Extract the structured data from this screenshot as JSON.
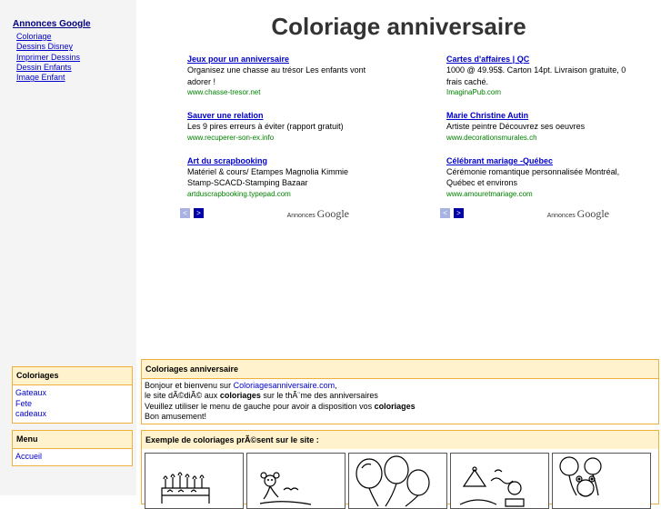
{
  "left": {
    "google_heading": "Annonces Google",
    "google_links": [
      "Coloriage",
      "Dessins Disney",
      "Imprimer Dessins",
      "Dessin Enfants",
      "Image Enfant"
    ],
    "coloriages_box": {
      "title": "Coloriages",
      "items": [
        "Gateaux",
        "Fete",
        "cadeaux"
      ]
    },
    "menu_box": {
      "title": "Menu",
      "items": [
        "Accueil"
      ]
    }
  },
  "main": {
    "title": "Coloriage anniversaire",
    "ads_left": [
      {
        "title": "Jeux pour un anniversaire",
        "text": "Organisez une chasse au trésor Les enfants vont adorer !",
        "url": "www.chasse-tresor.net"
      },
      {
        "title": "Sauver une relation",
        "text": "Les 9 pires erreurs à éviter (rapport gratuit)",
        "url": "www.recuperer-son-ex.info"
      },
      {
        "title": "Art du scrapbooking",
        "text": "Matériel & cours/ Etampes Magnolia Kimmie Stamp-SCACD-Stamping Bazaar",
        "url": "artduscrapbooking.typepad.com"
      }
    ],
    "ads_right": [
      {
        "title": "Cartes d'affaires | QC",
        "text": "1000 @ 49.95$. Carton 14pt. Livraison gratuite, 0 frais caché.",
        "url": "ImaginaPub.com"
      },
      {
        "title": "Marie Christine Autin",
        "text": "Artiste peintre Découvrez ses oeuvres",
        "url": "www.decorationsmurales.ch"
      },
      {
        "title": "Célébrant mariage -Québec",
        "text": "Cérémonie romantique personnalisée Montréal, Québec et environs",
        "url": "www.amouretmariage.com"
      }
    ],
    "ads_by_prefix": "Annonces",
    "ads_by_brand": "Google",
    "nav_prev": "<",
    "nav_next": ">",
    "intro_box": {
      "title": "Coloriages anniversaire",
      "line1_prefix": "Bonjour et bienvenu sur ",
      "line1_link": "Coloriagesanniversaire.com",
      "line1_suffix": ",",
      "line2_prefix": "le site dÃ©diÃ© aux ",
      "line2_bold": "coloriages",
      "line2_suffix": " sur le thÃ¨me des anniversaires",
      "line3_prefix": "Veuillez utiliser le menu de gauche pour avoir a disposition vos ",
      "line3_bold": "coloriages",
      "line4": "Bon amusement!"
    },
    "examples_box": {
      "title": "Exemple de coloriages prÃ©sent sur le site :"
    }
  },
  "colors": {
    "accent_border": "#f0b040",
    "box_header": "#fff2cc",
    "link": "#0000cc",
    "ad_url": "#008000",
    "left_bg": "#f4f4f4"
  }
}
